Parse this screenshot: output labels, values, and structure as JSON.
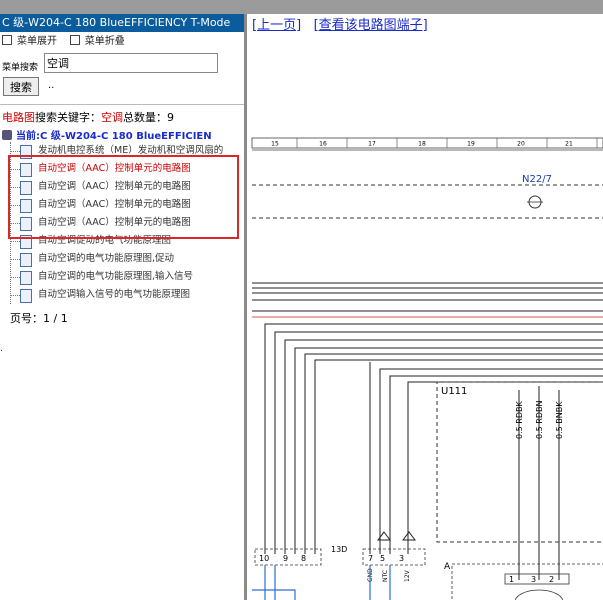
{
  "left": {
    "title": "C 级-W204-C 180 BlueEFFICIENCY T-Mode",
    "menu_expand": "菜单展开",
    "menu_collapse": "菜单折叠",
    "search_label": "菜单搜索",
    "search_value": "空调",
    "search_button": "搜索",
    "dots": "..",
    "summary_prefix": "电路图",
    "summary_mid": "搜索关键字：",
    "summary_keyword": "空调",
    "summary_count_label": "总数量：",
    "summary_count": "9",
    "current_label": "当前:C 级-W204-C 180 BlueEFFICIEN",
    "items": [
      "发动机电控系统（ME）发动机和空调风扇的",
      "自动空调（AAC）控制单元的电路图",
      "自动空调（AAC）控制单元的电路图",
      "自动空调（AAC）控制单元的电路图",
      "自动空调（AAC）控制单元的电路图",
      "自动空调促动的电气功能原理图",
      "自动空调的电气功能原理图,促动",
      "自动空调的电气功能原理图,输入信号",
      "自动空调输入信号的电气功能原理图"
    ],
    "pager_label": "页号：",
    "pager_value": "1 / 1",
    "bottom_dot": "."
  },
  "right": {
    "prev_page": "[上一页]",
    "view_terminal": "[查看该电路图端子]",
    "ruler": [
      "15",
      "16",
      "17",
      "18",
      "19",
      "20",
      "21"
    ],
    "component_n": "N22/7",
    "component_u": "U111",
    "wire_labels": [
      "0.5 RDBK",
      "0.5 RDBN",
      "0.5 BNBK"
    ],
    "left_pins": [
      "10",
      "9",
      "8"
    ],
    "connector": "13D",
    "mid_pins": [
      "7",
      "5",
      "3"
    ],
    "pin_labels_small": [
      "GND",
      "NTC",
      "12V"
    ],
    "bottom_pins": [
      "1",
      "3",
      "2"
    ],
    "connector_a": "A"
  }
}
